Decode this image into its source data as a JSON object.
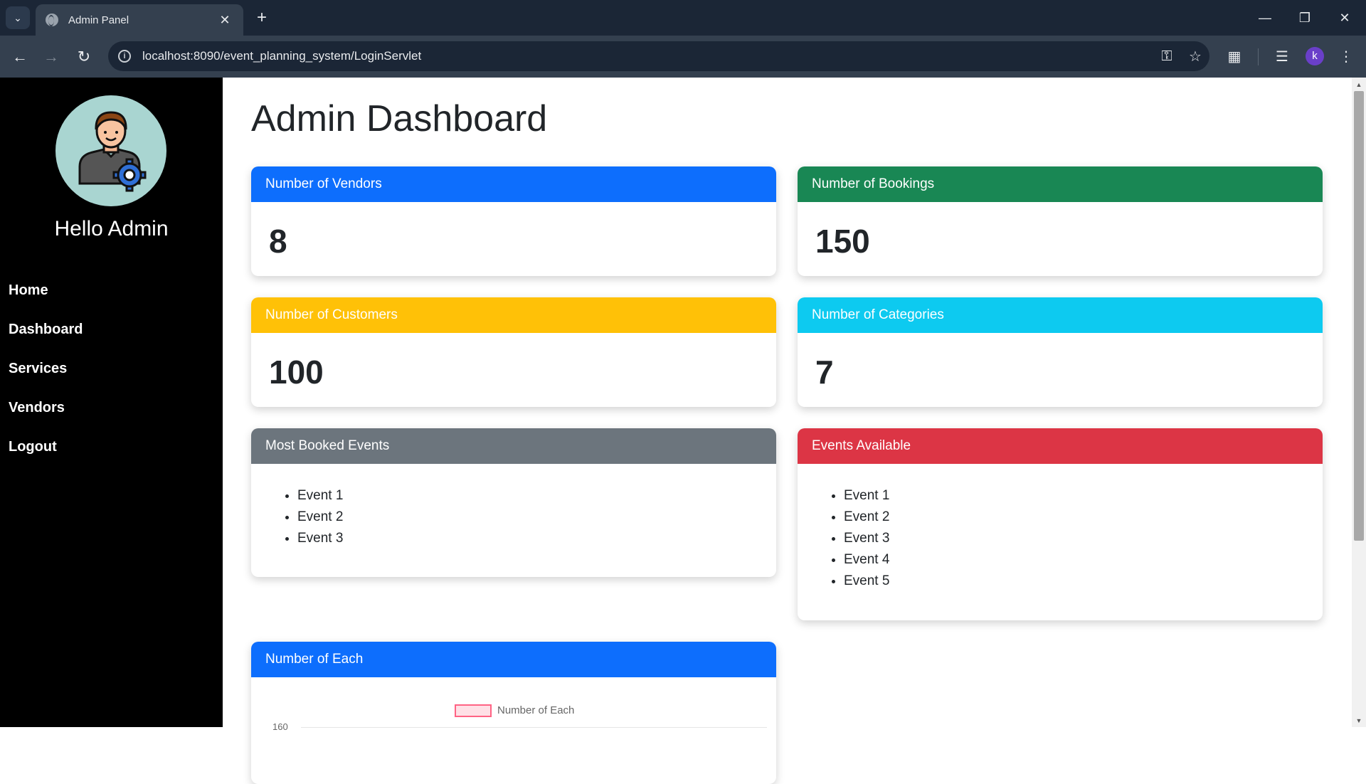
{
  "browser": {
    "tab_title": "Admin Panel",
    "url": "localhost:8090/event_planning_system/LoginServlet",
    "profile_initial": "k"
  },
  "sidebar": {
    "greeting": "Hello Admin",
    "nav": [
      {
        "label": "Home"
      },
      {
        "label": "Dashboard"
      },
      {
        "label": "Services"
      },
      {
        "label": "Vendors"
      },
      {
        "label": "Logout"
      }
    ]
  },
  "main": {
    "title": "Admin Dashboard",
    "cards": {
      "vendors": {
        "title": "Number of Vendors",
        "value": "8",
        "color": "#0d6efd"
      },
      "bookings": {
        "title": "Number of Bookings",
        "value": "150",
        "color": "#198754"
      },
      "customers": {
        "title": "Number of Customers",
        "value": "100",
        "color": "#ffc107"
      },
      "categories": {
        "title": "Number of Categories",
        "value": "7",
        "color": "#0dcaf0"
      },
      "most_booked": {
        "title": "Most Booked Events",
        "color": "#6c757d",
        "items": [
          "Event 1",
          "Event 2",
          "Event 3"
        ]
      },
      "available": {
        "title": "Events Available",
        "color": "#dc3545",
        "items": [
          "Event 1",
          "Event 2",
          "Event 3",
          "Event 4",
          "Event 5"
        ]
      },
      "chart": {
        "title": "Number of Each",
        "color": "#0d6efd",
        "legend": "Number of Each",
        "y_top_tick": "160"
      }
    }
  }
}
